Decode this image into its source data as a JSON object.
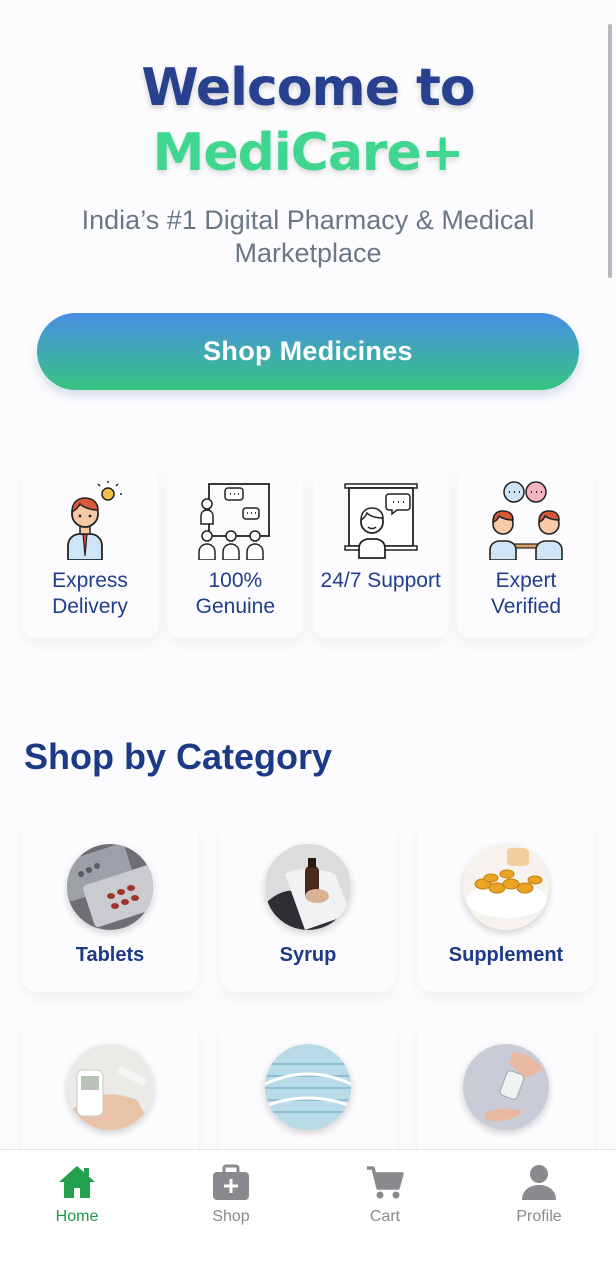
{
  "hero": {
    "title": "Welcome to",
    "brand": "MediCare+",
    "subtitle": "India’s #1 Digital Pharmacy & Medical Marketplace"
  },
  "cta": {
    "label": "Shop Medicines"
  },
  "features": [
    {
      "label": "Express Delivery",
      "icon": "delivery-person-icon"
    },
    {
      "label": "100% Genuine",
      "icon": "presentation-group-icon"
    },
    {
      "label": "24/7 Support",
      "icon": "support-screen-icon"
    },
    {
      "label": "Expert Verified",
      "icon": "experts-chat-icon"
    }
  ],
  "categories": {
    "title": "Shop by Category",
    "items": [
      {
        "label": "Tablets",
        "icon": "tablets-photo"
      },
      {
        "label": "Syrup",
        "icon": "syrup-photo"
      },
      {
        "label": "Supplement",
        "icon": "supplement-photo"
      },
      {
        "label": "",
        "icon": "glucometer-photo"
      },
      {
        "label": "",
        "icon": "face-mask-photo"
      },
      {
        "label": "",
        "icon": "sanitizer-photo"
      }
    ]
  },
  "nav": {
    "items": [
      {
        "label": "Home",
        "icon": "home-icon",
        "active": true
      },
      {
        "label": "Shop",
        "icon": "medical-bag-icon",
        "active": false
      },
      {
        "label": "Cart",
        "icon": "cart-icon",
        "active": false
      },
      {
        "label": "Profile",
        "icon": "user-icon",
        "active": false
      }
    ]
  },
  "colors": {
    "primary_navy": "#27418f",
    "brand_green": "#3fd68f",
    "button_gradient_top": "#4a8ee6",
    "button_gradient_bottom": "#36c47f",
    "active_nav": "#1f9a4b",
    "inactive_nav": "#8a8a8e"
  }
}
